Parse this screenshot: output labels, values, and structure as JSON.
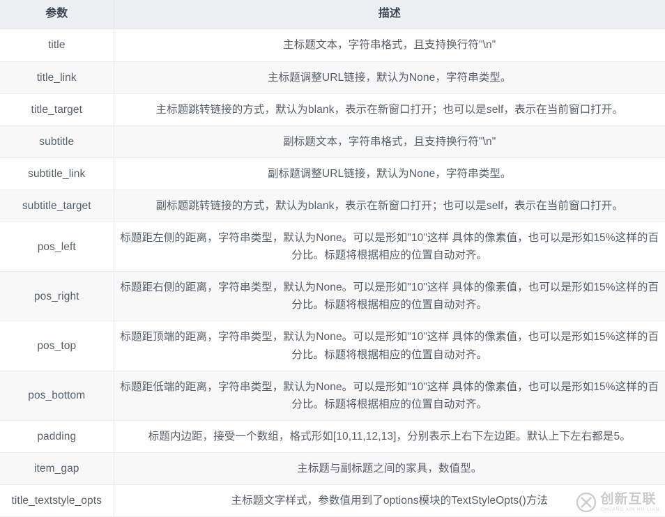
{
  "table": {
    "columns": [
      {
        "key": "param",
        "label": "参数"
      },
      {
        "key": "desc",
        "label": "描述"
      }
    ],
    "rows": [
      {
        "param": "title",
        "desc": "主标题文本，字符串格式，且支持换行符\"\\n\""
      },
      {
        "param": "title_link",
        "desc": "主标题调整URL链接，默认为None，字符串类型。"
      },
      {
        "param": "title_target",
        "desc": "主标题跳转链接的方式，默认为blank，表示在新窗口打开；也可以是self，表示在当前窗口打开。"
      },
      {
        "param": "subtitle",
        "desc": "副标题文本，字符串格式，且支持换行符\"\\n\""
      },
      {
        "param": "subtitle_link",
        "desc": "副标题调整URL链接，默认为None，字符串类型。"
      },
      {
        "param": "subtitle_target",
        "desc": "副标题跳转链接的方式，默认为blank，表示在新窗口打开；也可以是self，表示在当前窗口打开。"
      },
      {
        "param": "pos_left",
        "desc": "标题距左侧的距离，字符串类型，默认为None。可以是形如\"10\"这样 具体的像素值，也可以是形如15%这样的百分比。标题将根据相应的位置自动对齐。"
      },
      {
        "param": "pos_right",
        "desc": "标题距右侧的距离，字符串类型，默认为None。可以是形如\"10\"这样 具体的像素值，也可以是形如15%这样的百分比。标题将根据相应的位置自动对齐。"
      },
      {
        "param": "pos_top",
        "desc": "标题距顶端的距离，字符串类型，默认为None。可以是形如\"10\"这样 具体的像素值，也可以是形如15%这样的百分比。标题将根据相应的位置自动对齐。"
      },
      {
        "param": "pos_bottom",
        "desc": "标题距低端的距离，字符串类型，默认为None。可以是形如\"10\"这样 具体的像素值，也可以是形如15%这样的百分比。标题将根据相应的位置自动对齐。"
      },
      {
        "param": "padding",
        "desc": "标题内边距，接受一个数组，格式形如[10,11,12,13]，分别表示上右下左边距。默认上下左右都是5。"
      },
      {
        "param": "item_gap",
        "desc": "主标题与副标题之间的家具，数值型。"
      },
      {
        "param": "title_textstyle_opts",
        "desc": "主标题文字样式，参数值用到了options模块的TextStyleOpts()方法"
      }
    ]
  },
  "watermark": {
    "brand": "创新互联",
    "pinyin": "CHUANG XIN HU LIAN",
    "logo_letter": "X"
  },
  "colors": {
    "header_bg": "#ecf0f3",
    "stripe_bg": "#f8f8f9",
    "row_bg": "#ffffff",
    "border": "#ededef",
    "text": "#57606a"
  }
}
